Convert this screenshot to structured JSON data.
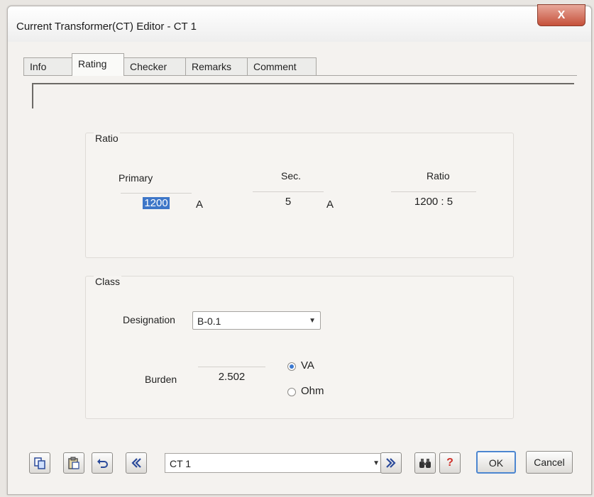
{
  "window": {
    "title": "Current Transformer(CT) Editor - CT 1",
    "close_glyph": "X"
  },
  "tabs": [
    {
      "label": "Info",
      "active": false
    },
    {
      "label": "Rating",
      "active": true
    },
    {
      "label": "Checker",
      "active": false
    },
    {
      "label": "Remarks",
      "active": false
    },
    {
      "label": "Comment",
      "active": false
    }
  ],
  "ratio": {
    "group_label": "Ratio",
    "primary_label": "Primary",
    "primary_value": "1200",
    "primary_unit": "A",
    "sec_label": "Sec.",
    "sec_value": "5",
    "sec_unit": "A",
    "ratio_label": "Ratio",
    "ratio_value": "1200 : 5"
  },
  "class": {
    "group_label": "Class",
    "designation_label": "Designation",
    "designation_value": "B-0.1",
    "burden_label": "Burden",
    "burden_value": "2.502",
    "unit_options": [
      {
        "label": "VA",
        "checked": true
      },
      {
        "label": "Ohm",
        "checked": false
      }
    ]
  },
  "toolbar": {
    "copy_icon": "copy-icon",
    "paste_icon": "paste-icon",
    "undo_icon": "undo-icon",
    "prev_icon": "previous-icon",
    "record_value": "CT 1",
    "next_icon": "next-icon",
    "find_icon": "binoculars-icon",
    "help_glyph": "?",
    "ok_label": "OK",
    "cancel_label": "Cancel"
  },
  "colors": {
    "selection": "#3d76c8",
    "close_button": "#c5503a",
    "help": "#d0322a"
  }
}
